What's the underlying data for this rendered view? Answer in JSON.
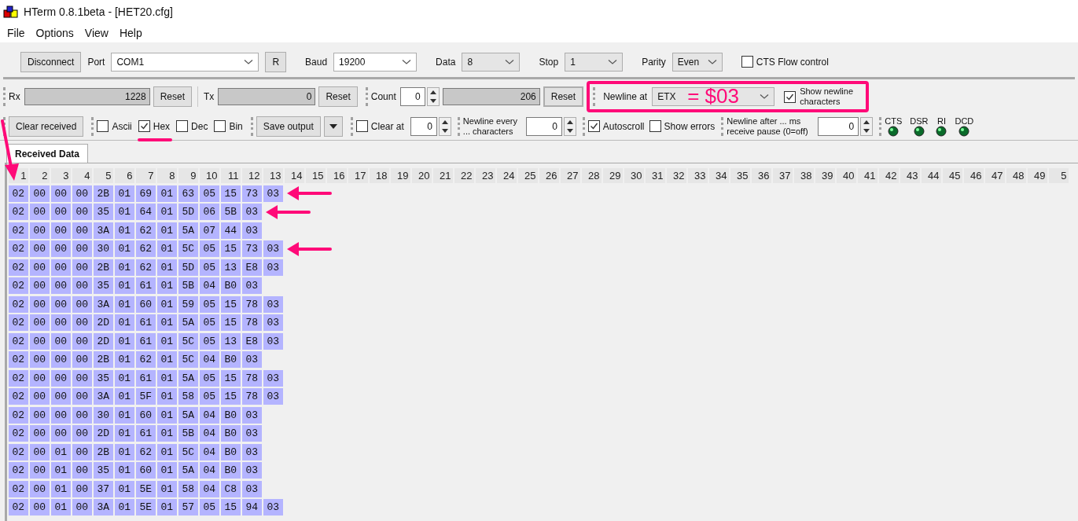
{
  "window": {
    "title": "HTerm 0.8.1beta - [HET20.cfg]"
  },
  "menu": [
    "File",
    "Options",
    "View",
    "Help"
  ],
  "connection": {
    "disconnect": "Disconnect",
    "port_label": "Port",
    "port": "COM1",
    "refresh": "R",
    "baud_label": "Baud",
    "baud": "19200",
    "data_label": "Data",
    "data": "8",
    "stop_label": "Stop",
    "stop": "1",
    "parity_label": "Parity",
    "parity": "Even",
    "cts_flow": {
      "label": "CTS Flow control",
      "checked": false
    }
  },
  "counters": {
    "rx_label": "Rx",
    "rx": "1228",
    "rx_reset": "Reset",
    "tx_label": "Tx",
    "tx": "0",
    "tx_reset": "Reset",
    "count_label": "Count",
    "count": "0",
    "count_value": "206",
    "count_reset": "Reset"
  },
  "newline": {
    "label": "Newline at",
    "value": "ETX",
    "annotation": "= $03",
    "show_chars": {
      "label": "Show newline characters",
      "checked": true
    }
  },
  "display": {
    "clear_received": "Clear received",
    "formats": [
      {
        "label": "Ascii",
        "checked": false
      },
      {
        "label": "Hex",
        "checked": true
      },
      {
        "label": "Dec",
        "checked": false
      },
      {
        "label": "Bin",
        "checked": false
      }
    ],
    "save_output": "Save output",
    "clear_at": {
      "label": "Clear at",
      "checked": false,
      "value": "0"
    },
    "newline_every": {
      "label": "Newline every ... characters",
      "value": "0"
    },
    "autoscroll": {
      "label": "Autoscroll",
      "checked": true
    },
    "show_errors": {
      "label": "Show errors",
      "checked": false
    },
    "newline_after": {
      "label": "Newline after ... ms receive pause (0=off)",
      "value": "0"
    },
    "signals": [
      {
        "label": "CTS",
        "on": true
      },
      {
        "label": "DSR",
        "on": true
      },
      {
        "label": "RI",
        "on": true
      },
      {
        "label": "DCD",
        "on": true
      }
    ]
  },
  "tab": {
    "label": "Received Data",
    "selected": true
  },
  "grid": {
    "columns": [
      "1",
      "2",
      "3",
      "4",
      "5",
      "6",
      "7",
      "8",
      "9",
      "10",
      "11",
      "12",
      "13",
      "14",
      "15",
      "16",
      "17",
      "18",
      "19",
      "20",
      "21",
      "22",
      "23",
      "24",
      "25",
      "26",
      "27",
      "28",
      "29",
      "30",
      "31",
      "32",
      "33",
      "34",
      "35",
      "36",
      "37",
      "38",
      "39",
      "40",
      "41",
      "42",
      "43",
      "44",
      "45",
      "46",
      "47",
      "48",
      "49",
      "5"
    ],
    "rows": [
      {
        "marked": true,
        "bytes": [
          "02",
          "00",
          "00",
          "00",
          "2B",
          "01",
          "69",
          "01",
          "63",
          "05",
          "15",
          "73",
          "03"
        ]
      },
      {
        "marked": true,
        "bytes": [
          "02",
          "00",
          "00",
          "00",
          "35",
          "01",
          "64",
          "01",
          "5D",
          "06",
          "5B",
          "03"
        ]
      },
      {
        "marked": false,
        "bytes": [
          "02",
          "00",
          "00",
          "00",
          "3A",
          "01",
          "62",
          "01",
          "5A",
          "07",
          "44",
          "03"
        ]
      },
      {
        "marked": true,
        "bytes": [
          "02",
          "00",
          "00",
          "00",
          "30",
          "01",
          "62",
          "01",
          "5C",
          "05",
          "15",
          "73",
          "03"
        ]
      },
      {
        "marked": false,
        "bytes": [
          "02",
          "00",
          "00",
          "00",
          "2B",
          "01",
          "62",
          "01",
          "5D",
          "05",
          "13",
          "E8",
          "03"
        ]
      },
      {
        "marked": false,
        "bytes": [
          "02",
          "00",
          "00",
          "00",
          "35",
          "01",
          "61",
          "01",
          "5B",
          "04",
          "B0",
          "03"
        ]
      },
      {
        "marked": false,
        "bytes": [
          "02",
          "00",
          "00",
          "00",
          "3A",
          "01",
          "60",
          "01",
          "59",
          "05",
          "15",
          "78",
          "03"
        ]
      },
      {
        "marked": false,
        "bytes": [
          "02",
          "00",
          "00",
          "00",
          "2D",
          "01",
          "61",
          "01",
          "5A",
          "05",
          "15",
          "78",
          "03"
        ]
      },
      {
        "marked": false,
        "bytes": [
          "02",
          "00",
          "00",
          "00",
          "2D",
          "01",
          "61",
          "01",
          "5C",
          "05",
          "13",
          "E8",
          "03"
        ]
      },
      {
        "marked": false,
        "bytes": [
          "02",
          "00",
          "00",
          "00",
          "2B",
          "01",
          "62",
          "01",
          "5C",
          "04",
          "B0",
          "03"
        ]
      },
      {
        "marked": false,
        "bytes": [
          "02",
          "00",
          "00",
          "00",
          "35",
          "01",
          "61",
          "01",
          "5A",
          "05",
          "15",
          "78",
          "03"
        ]
      },
      {
        "marked": false,
        "bytes": [
          "02",
          "00",
          "00",
          "00",
          "3A",
          "01",
          "5F",
          "01",
          "58",
          "05",
          "15",
          "78",
          "03"
        ]
      },
      {
        "marked": false,
        "bytes": [
          "02",
          "00",
          "00",
          "00",
          "30",
          "01",
          "60",
          "01",
          "5A",
          "04",
          "B0",
          "03"
        ]
      },
      {
        "marked": false,
        "bytes": [
          "02",
          "00",
          "00",
          "00",
          "2D",
          "01",
          "61",
          "01",
          "5B",
          "04",
          "B0",
          "03"
        ]
      },
      {
        "marked": false,
        "bytes": [
          "02",
          "00",
          "01",
          "00",
          "2B",
          "01",
          "62",
          "01",
          "5C",
          "04",
          "B0",
          "03"
        ]
      },
      {
        "marked": false,
        "bytes": [
          "02",
          "00",
          "01",
          "00",
          "35",
          "01",
          "60",
          "01",
          "5A",
          "04",
          "B0",
          "03"
        ]
      },
      {
        "marked": false,
        "bytes": [
          "02",
          "00",
          "01",
          "00",
          "37",
          "01",
          "5E",
          "01",
          "58",
          "04",
          "C8",
          "03"
        ]
      },
      {
        "marked": false,
        "bytes": [
          "02",
          "00",
          "01",
          "00",
          "3A",
          "01",
          "5E",
          "01",
          "57",
          "05",
          "15",
          "94",
          "03"
        ]
      }
    ]
  }
}
